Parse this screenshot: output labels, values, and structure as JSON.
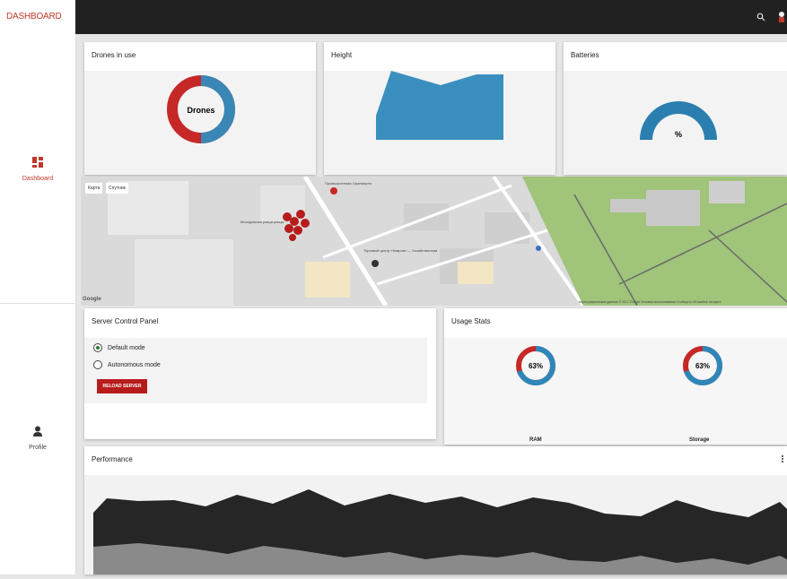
{
  "header": {
    "logo": "DASHBOARD"
  },
  "sidebar": {
    "items": [
      {
        "label": "Dashboard",
        "icon": "dashboard-icon",
        "active": true
      },
      {
        "label": "Profile",
        "icon": "person-icon",
        "active": false
      }
    ]
  },
  "cards": {
    "drones": {
      "title": "Drones in use",
      "center_label": "Drones"
    },
    "height": {
      "title": "Height"
    },
    "batteries": {
      "title": "Batteries",
      "center_label": "%"
    }
  },
  "map": {
    "type_buttons": [
      "Карта",
      "Спутник"
    ],
    "google_logo": "Google",
    "labels": [
      "Промышленная Оранжерея",
      "Молодежная улица улица",
      "Торговый центр «Ковров» — Хозяйственная"
    ],
    "footer": "Картографические данные © 2017 Google   Условия использования   Сообщить об ошибке на карте"
  },
  "server_panel": {
    "title": "Server Control Panel",
    "modes": [
      "Default mode",
      "Autonomous mode"
    ],
    "selected_mode": "Default mode",
    "button_label": "RELOAD SERVER"
  },
  "usage_stats": {
    "title": "Usage Stats",
    "items": [
      {
        "label": "RAM",
        "value": "63%"
      },
      {
        "label": "Storage",
        "value": "63%"
      }
    ]
  },
  "performance": {
    "title": "Performance"
  },
  "colors": {
    "accent": "#c0392b",
    "blue": "#3a87b6",
    "topbar": "#212121"
  }
}
